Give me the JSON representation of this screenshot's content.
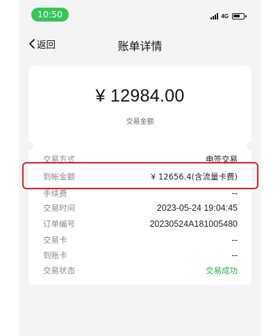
{
  "status_bar": {
    "time": "10:50",
    "network": "4G"
  },
  "nav": {
    "back_label": "返回",
    "title": "账单详情"
  },
  "summary": {
    "amount": "¥ 12984.00",
    "label": "交易金额"
  },
  "details": [
    {
      "key": "交易方式",
      "value": "电签交易"
    },
    {
      "key": "到帐金额",
      "value": "¥ 12656.4(含流量卡费)"
    },
    {
      "key": "手续费",
      "value": "--"
    },
    {
      "key": "交易时间",
      "value": "2023-05-24 19:04:45"
    },
    {
      "key": "订单编号",
      "value": "20230524A181005480"
    },
    {
      "key": "交易卡",
      "value": "--"
    },
    {
      "key": "到账卡",
      "value": "--"
    },
    {
      "key": "交易状态",
      "value": "交易成功"
    }
  ],
  "colors": {
    "time_pill": "#35c759",
    "highlight": "#e01931",
    "success": "#2bb14f",
    "background": "#f4f4f4"
  }
}
